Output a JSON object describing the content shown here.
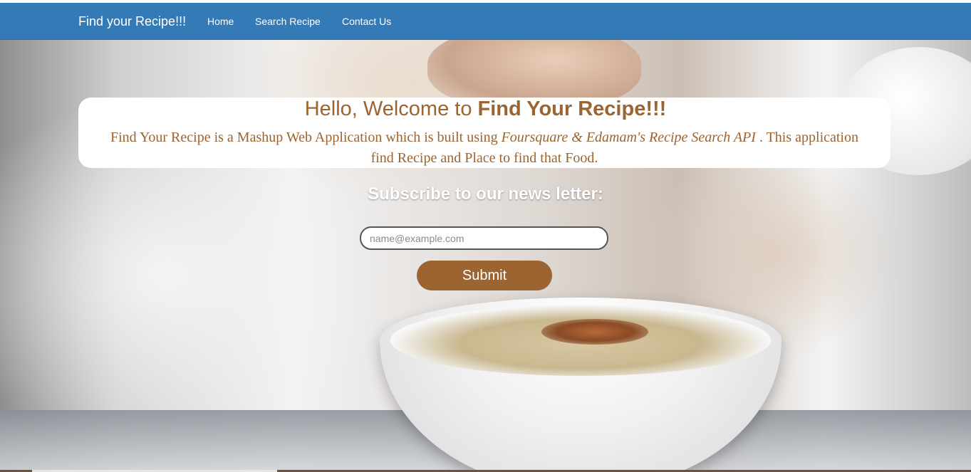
{
  "navbar": {
    "brand": "Find your Recipe!!!",
    "links": [
      "Home",
      "Search Recipe",
      "Contact Us"
    ]
  },
  "hero": {
    "title_prefix": "Hello, Welcome to ",
    "title_strong": "Find Your Recipe!!!",
    "description_start": "Find Your Recipe is a Mashup Web Application which is built using ",
    "description_italic": "Foursquare & Edamam's Recipe Search API",
    "description_end": " . This application find Recipe and Place to find that Food."
  },
  "subscribe": {
    "heading": "Subscribe to our news letter:",
    "email_placeholder": "name@example.com",
    "email_value": "",
    "submit_label": "Submit"
  },
  "colors": {
    "navbar": "#337ab7",
    "accent_brown": "#9b6430",
    "card_background": "#ffffff"
  }
}
